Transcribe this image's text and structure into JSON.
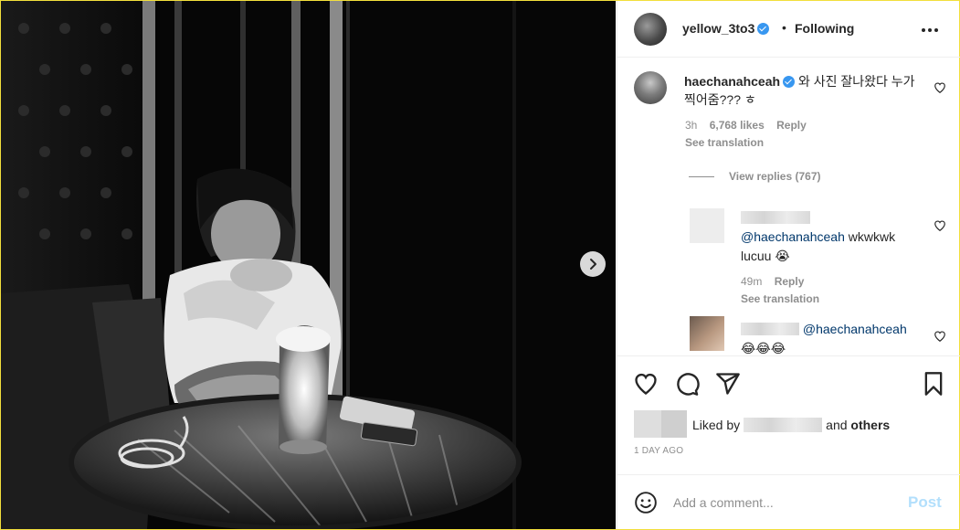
{
  "post": {
    "username": "yellow_3to3",
    "verified": true,
    "separator": "•",
    "follow_status": "Following",
    "more_icon": "more-options-icon"
  },
  "photo": {
    "next_icon": "chevron-right-icon"
  },
  "comments": [
    {
      "username": "haechanahceah",
      "verified": true,
      "text": "와 사진 잘나왔다 누가 찍어줌??? ㅎ",
      "time": "3h",
      "likes": "6,768 likes",
      "reply_label": "Reply",
      "see_translation": "See translation",
      "view_replies": "View replies (767)"
    }
  ],
  "replies": [
    {
      "mention": "@haechanahceah",
      "text": "wkwkwk lucuu",
      "emoji": "😭",
      "time": "49m",
      "reply_label": "Reply",
      "see_translation": "See translation"
    },
    {
      "mention": "@haechanahceah",
      "emoji": "😂😂😂"
    }
  ],
  "actions": {
    "like_icon": "heart-icon",
    "comment_icon": "comment-icon",
    "share_icon": "share-icon",
    "save_icon": "bookmark-icon"
  },
  "likes_summary": {
    "prefix": "Liked by",
    "middle": "and",
    "suffix": "others"
  },
  "timestamp": "1 DAY AGO",
  "add_comment": {
    "placeholder": "Add a comment...",
    "post_label": "Post",
    "emoji_icon": "smiley-icon"
  },
  "colors": {
    "link": "#00376b",
    "verified": "#3897f0",
    "muted": "#8e8e8e",
    "post_disabled": "#b2dffc"
  }
}
